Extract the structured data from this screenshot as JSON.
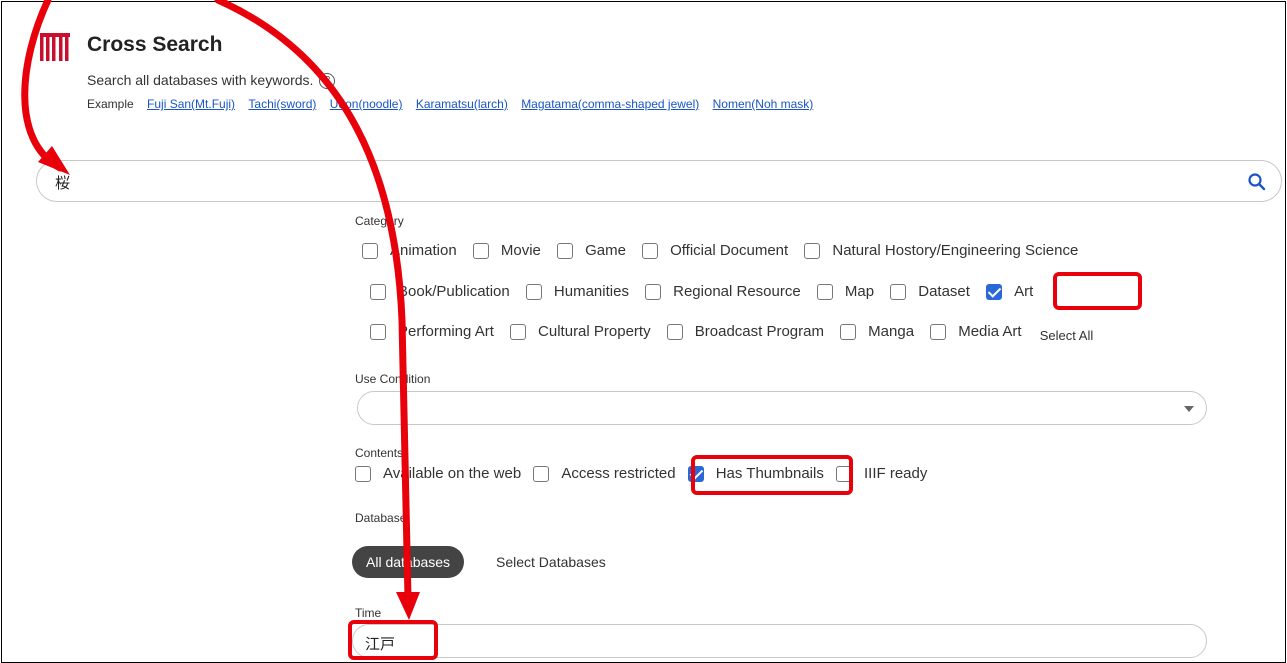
{
  "app": {
    "title": "Cross Search",
    "logo_icon": "mn-logo-icon",
    "brand_color": "#e8000b"
  },
  "header": {
    "subtitle": "Search all databases with keywords.",
    "help_symbol": "?",
    "examples_label": "Example",
    "examples": [
      "Fuji San(Mt.Fuji)",
      "Tachi(sword)",
      "Udon(noodle)",
      "Karamatsu(larch)",
      "Magatama(comma-shaped jewel)",
      "Nomen(Noh mask)"
    ]
  },
  "search": {
    "value": "桜",
    "icon": "search-icon"
  },
  "category": {
    "label": "Category",
    "row1": [
      {
        "label": "Animation",
        "checked": false
      },
      {
        "label": "Movie",
        "checked": false
      },
      {
        "label": "Game",
        "checked": false
      },
      {
        "label": "Official Document",
        "checked": false
      },
      {
        "label": "Natural Hostory/Engineering Science",
        "checked": false
      }
    ],
    "row2": [
      {
        "label": "Book/Publication",
        "checked": false
      },
      {
        "label": "Humanities",
        "checked": false
      },
      {
        "label": "Regional Resource",
        "checked": false
      },
      {
        "label": "Map",
        "checked": false
      },
      {
        "label": "Dataset",
        "checked": false
      },
      {
        "label": "Art",
        "checked": true
      }
    ],
    "row3": [
      {
        "label": "Performing Art",
        "checked": false
      },
      {
        "label": "Cultural Property",
        "checked": false
      },
      {
        "label": "Broadcast Program",
        "checked": false
      },
      {
        "label": "Manga",
        "checked": false
      },
      {
        "label": "Media Art",
        "checked": false
      }
    ],
    "select_all": "Select All"
  },
  "use_condition": {
    "label": "Use Condition",
    "value": ""
  },
  "contents": {
    "label": "Contents",
    "items": [
      {
        "label": "Available on the web",
        "checked": false
      },
      {
        "label": "Access restricted",
        "checked": false
      },
      {
        "label": "Has Thumbnails",
        "checked": true
      },
      {
        "label": "IIIF ready",
        "checked": false
      }
    ]
  },
  "database": {
    "label": "Database",
    "tabs": [
      "All databases",
      "Select Databases"
    ]
  },
  "time": {
    "label": "Time",
    "value": "江戸"
  },
  "annotations": {
    "color": "#e8000b"
  }
}
